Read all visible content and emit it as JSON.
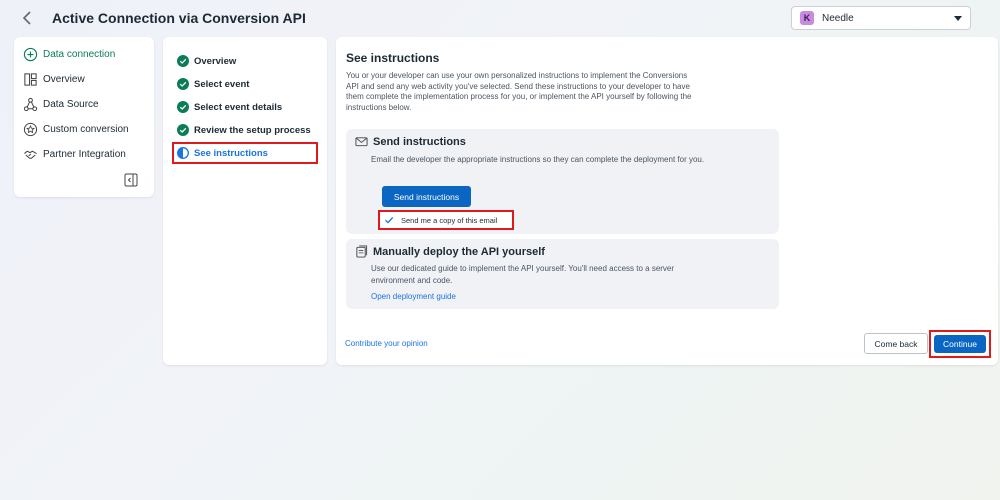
{
  "header": {
    "title": "Active Connection via Conversion API",
    "account": {
      "initial": "K",
      "name": "Needle"
    }
  },
  "left_nav": {
    "items": [
      {
        "label": "Data connection",
        "icon": "plus-circle-icon",
        "active": true
      },
      {
        "label": "Overview",
        "icon": "layout-icon"
      },
      {
        "label": "Data Source",
        "icon": "network-icon"
      },
      {
        "label": "Custom conversion",
        "icon": "star-badge-icon"
      },
      {
        "label": "Partner Integration",
        "icon": "handshake-icon"
      }
    ]
  },
  "steps": {
    "items": [
      {
        "label": "Overview",
        "status": "done"
      },
      {
        "label": "Select event",
        "status": "done"
      },
      {
        "label": "Select event details",
        "status": "done"
      },
      {
        "label": "Review the setup process",
        "status": "done"
      },
      {
        "label": "See instructions",
        "status": "current"
      }
    ]
  },
  "main": {
    "title": "See instructions",
    "description": "You or your developer can use your own personalized instructions to implement the Conversions API and send any web activity you've selected. Send these instructions to your developer to have them complete the implementation process for you, or implement the API yourself by following the instructions below.",
    "send_card": {
      "title": "Send instructions",
      "description": "Email the developer the appropriate instructions so they can complete the deployment for you.",
      "button_label": "Send instructions",
      "copy_label": "Send me a copy of this email",
      "copy_checked": true
    },
    "manual_card": {
      "title": "Manually deploy the API yourself",
      "description": "Use our dedicated guide to implement the API yourself. You'll need access to a server environment and code.",
      "link_label": "Open deployment guide"
    },
    "opinion_link": "Contribute your opinion",
    "come_back_label": "Come back",
    "continue_label": "Continue"
  },
  "colors": {
    "accent": "#0a66c2",
    "link": "#1b74e4",
    "done_green": "#0a7d57",
    "highlight": "#e0191e"
  }
}
